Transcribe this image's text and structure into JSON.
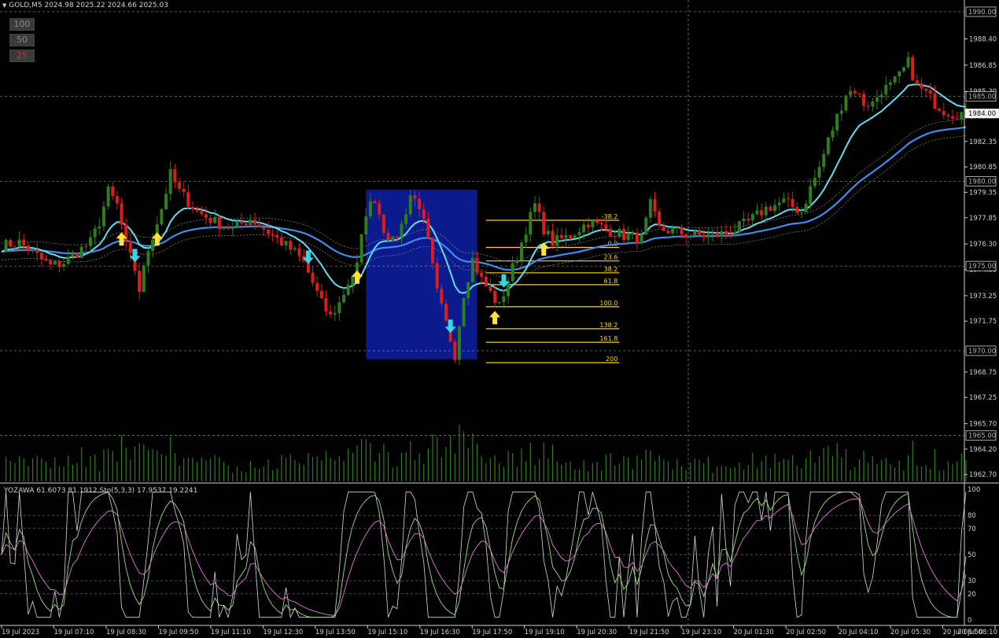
{
  "header": {
    "symbol_line": "GOLD,M5  2024.98 2025.22 2024.66 2025.03"
  },
  "zoom_buttons": [
    {
      "label": "100",
      "color": "#8a8a8a"
    },
    {
      "label": "50",
      "color": "#8a8a8a"
    },
    {
      "label": "25",
      "color": "#cc3333"
    }
  ],
  "price_axis": {
    "labels": [
      "1988.40",
      "1986.85",
      "1985.30",
      "1983.85",
      "1982.35",
      "1980.85",
      "1979.35",
      "1977.85",
      "1976.30",
      "1974.80",
      "1973.25",
      "1971.75",
      "1968.75",
      "1967.25",
      "1965.70",
      "1964.20",
      "1962.70"
    ],
    "boxed_labels": [
      "1990.00",
      "1985.00",
      "1980.00",
      "1975.00",
      "1970.00",
      "1965.00"
    ],
    "current_price": "1984.00"
  },
  "oscillator": {
    "legend": "YOZAWA 61.6073 81.1912  Sto(5,3,3) 17.9537 19.2241",
    "levels": [
      "100",
      "80",
      "70",
      "50",
      "30",
      "20",
      "0"
    ]
  },
  "time_axis": {
    "labels": [
      "19 Jul 2023",
      "19 Jul 07:10",
      "19 Jul 08:30",
      "19 Jul 09:50",
      "19 Jul 11:10",
      "19 Jul 12:30",
      "19 Jul 13:50",
      "19 Jul 15:10",
      "19 Jul 16:30",
      "19 Jul 17:50",
      "19 Jul 19:10",
      "19 Jul 20:30",
      "19 Jul 21:50",
      "19 Jul 23:10",
      "20 Jul 01:30",
      "20 Jul 02:50",
      "20 Jul 04:10",
      "20 Jul 05:30",
      "20 Jul 06:50",
      "20 Jul 08:10"
    ]
  },
  "fibonacci": {
    "levels": [
      "-38.2",
      "0.0",
      "23.6",
      "38.2",
      "61.8",
      "100.0",
      "138.2",
      "161.8",
      "200"
    ]
  },
  "colors": {
    "bull": "#2e7d1e",
    "bear": "#dd1c1c",
    "ma_fast": "#5ce0f0",
    "ma_slow": "#3f8cf0",
    "ma_mid": "#e0509a",
    "fib": "#ffd400",
    "box": "#0b1a8c",
    "up_arrow": "#ffe23a",
    "down_arrow": "#36d6e6",
    "grid": "#c8c8c8",
    "text": "#cfcfcf"
  },
  "chart_data": {
    "type": "candlestick",
    "symbol": "GOLD",
    "timeframe": "M5",
    "ylim": [
      1962.2,
      1990.6
    ],
    "price_path": [
      [
        0,
        1976.2
      ],
      [
        4,
        1976.4
      ],
      [
        8,
        1975.6
      ],
      [
        11,
        1975.0
      ],
      [
        14,
        1975.2
      ],
      [
        17,
        1975.8
      ],
      [
        20,
        1976.4
      ],
      [
        22,
        1977.6
      ],
      [
        24,
        1979.4
      ],
      [
        26,
        1978.6
      ],
      [
        28,
        1976.2
      ],
      [
        30,
        1974.8
      ],
      [
        31,
        1973.6
      ],
      [
        33,
        1976.0
      ],
      [
        36,
        1978.4
      ],
      [
        38,
        1980.4
      ],
      [
        40,
        1979.4
      ],
      [
        44,
        1978.2
      ],
      [
        48,
        1977.6
      ],
      [
        52,
        1977.2
      ],
      [
        56,
        1977.8
      ],
      [
        60,
        1977.0
      ],
      [
        64,
        1976.2
      ],
      [
        66,
        1975.8
      ],
      [
        68,
        1975.2
      ],
      [
        70,
        1974.0
      ],
      [
        72,
        1972.8
      ],
      [
        74,
        1972.0
      ],
      [
        76,
        1972.8
      ],
      [
        78,
        1974.0
      ],
      [
        80,
        1975.0
      ],
      [
        82,
        1978.2
      ],
      [
        84,
        1979.0
      ],
      [
        86,
        1977.2
      ],
      [
        88,
        1976.4
      ],
      [
        90,
        1977.4
      ],
      [
        92,
        1979.2
      ],
      [
        94,
        1978.6
      ],
      [
        96,
        1976.4
      ],
      [
        98,
        1973.4
      ],
      [
        100,
        1971.6
      ],
      [
        102,
        1969.8
      ],
      [
        104,
        1973.4
      ],
      [
        106,
        1975.4
      ],
      [
        108,
        1974.2
      ],
      [
        110,
        1973.4
      ],
      [
        112,
        1972.6
      ],
      [
        114,
        1974.2
      ],
      [
        116,
        1975.6
      ],
      [
        118,
        1977.2
      ],
      [
        120,
        1978.6
      ],
      [
        122,
        1977.2
      ],
      [
        124,
        1976.4
      ],
      [
        128,
        1976.8
      ],
      [
        132,
        1977.6
      ],
      [
        136,
        1977.2
      ],
      [
        140,
        1976.8
      ],
      [
        144,
        1976.6
      ],
      [
        146,
        1978.6
      ],
      [
        148,
        1977.2
      ],
      [
        152,
        1977.0
      ],
      [
        156,
        1976.8
      ],
      [
        160,
        1976.8
      ],
      [
        164,
        1977.0
      ],
      [
        168,
        1977.6
      ],
      [
        172,
        1978.4
      ],
      [
        176,
        1978.8
      ],
      [
        180,
        1978.2
      ],
      [
        182,
        1979.6
      ],
      [
        184,
        1980.8
      ],
      [
        186,
        1982.4
      ],
      [
        188,
        1983.8
      ],
      [
        190,
        1985.2
      ],
      [
        192,
        1985.4
      ],
      [
        194,
        1984.6
      ],
      [
        196,
        1984.6
      ],
      [
        198,
        1985.4
      ],
      [
        200,
        1985.6
      ],
      [
        202,
        1986.2
      ],
      [
        204,
        1987.0
      ],
      [
        206,
        1985.6
      ],
      [
        208,
        1985.2
      ],
      [
        210,
        1984.6
      ],
      [
        212,
        1984.2
      ],
      [
        214,
        1984.0
      ],
      [
        216,
        1984.0
      ],
      [
        217,
        1984.0
      ]
    ],
    "fib_levels": [
      {
        "level": "-38.2",
        "price": 1977.7
      },
      {
        "level": "0.0",
        "price": 1976.1
      },
      {
        "level": "23.6",
        "price": 1975.3
      },
      {
        "level": "38.2",
        "price": 1974.6
      },
      {
        "level": "61.8",
        "price": 1973.9
      },
      {
        "level": "100.0",
        "price": 1972.6
      },
      {
        "level": "138.2",
        "price": 1971.3
      },
      {
        "level": "161.8",
        "price": 1970.5
      },
      {
        "level": "200",
        "price": 1969.3
      }
    ],
    "rect_zone": {
      "from_bar": 82,
      "to_bar": 107,
      "high": 1979.5,
      "low": 1969.5
    },
    "up_arrows": [
      27,
      35,
      80,
      111,
      122
    ],
    "down_arrows": [
      30,
      69,
      101,
      113
    ]
  }
}
